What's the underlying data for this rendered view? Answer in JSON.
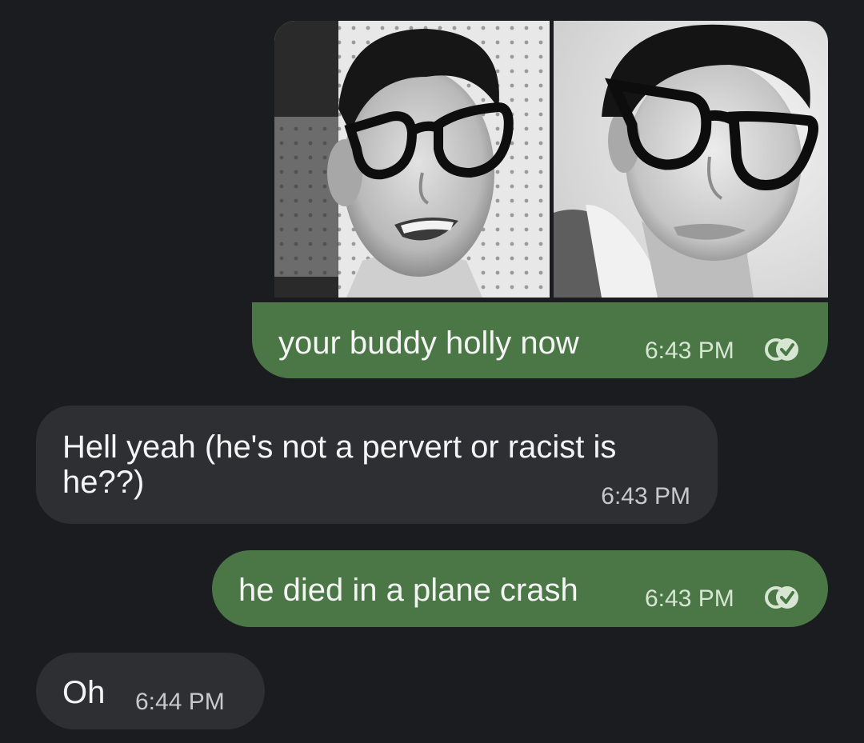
{
  "conversation": {
    "messages": [
      {
        "direction": "outgoing",
        "attachment": {
          "type": "photos",
          "images": [
            {
              "name": "photo-left"
            },
            {
              "name": "photo-right"
            }
          ]
        },
        "text": "your buddy holly now",
        "time": "6:43 PM",
        "receipt": "read-check-icon"
      },
      {
        "direction": "incoming",
        "text": "Hell yeah (he's not a pervert or racist is he??)",
        "time": "6:43 PM"
      },
      {
        "direction": "outgoing",
        "text": "he died in a plane crash",
        "time": "6:43 PM",
        "receipt": "read-check-icon"
      },
      {
        "direction": "incoming",
        "text": "Oh",
        "time": "6:44 PM"
      }
    ]
  },
  "theme": {
    "background": "#1b1c20",
    "outgoing_bubble": "#4a7745",
    "incoming_bubble": "#2e2f33",
    "text": "#f4f4f4"
  }
}
